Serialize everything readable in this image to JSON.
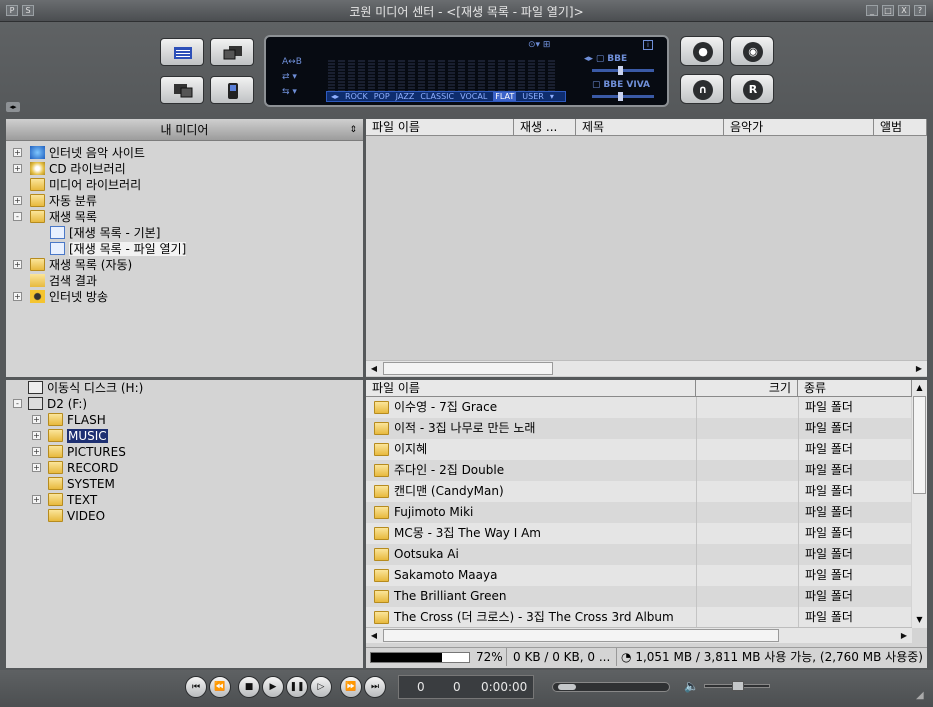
{
  "window": {
    "title": "코원 미디어 센터 - <[재생 목록 - 파일 열기]>",
    "left_buttons": [
      "P",
      "S"
    ],
    "right_buttons": [
      "_",
      "□",
      "X",
      "?"
    ]
  },
  "eq": {
    "ab": "A↔B",
    "presets": [
      "ROCK",
      "POP",
      "JAZZ",
      "CLASSIC",
      "VOCAL",
      "FLAT",
      "USER"
    ],
    "selected_preset": "FLAT",
    "bbe": "BBE",
    "viva": "BBE VIVA",
    "info": "i",
    "slider1_level": 0.45,
    "slider2_level": 0.45
  },
  "my_media": {
    "header": "내 미디어",
    "items": [
      {
        "label": "인터넷 음악 사이트",
        "expander": "+"
      },
      {
        "label": "CD 라이브러리",
        "expander": "+"
      },
      {
        "label": "미디어 라이브러리",
        "expander": ""
      },
      {
        "label": "자동 분류",
        "expander": "+"
      },
      {
        "label": "재생 목록",
        "expander": "-"
      },
      {
        "label": "[재생 목록 - 기본]",
        "expander": ""
      },
      {
        "label": "[재생 목록 - 파일 열기]",
        "expander": ""
      },
      {
        "label": "재생 목록 (자동)",
        "expander": "+"
      },
      {
        "label": "검색 결과",
        "expander": ""
      },
      {
        "label": "인터넷 방송",
        "expander": "+"
      }
    ]
  },
  "playlist": {
    "columns": [
      "파일 이름",
      "재생 ...",
      "제목",
      "음악가",
      "앨범"
    ]
  },
  "drives": {
    "items": [
      {
        "label": "이동식 디스크 (H:)",
        "expander": ""
      },
      {
        "label": "D2 (F:)",
        "expander": "-"
      },
      {
        "label": "FLASH",
        "expander": "+"
      },
      {
        "label": "MUSIC",
        "expander": "+"
      },
      {
        "label": "PICTURES",
        "expander": "+"
      },
      {
        "label": "RECORD",
        "expander": "+"
      },
      {
        "label": "SYSTEM",
        "expander": ""
      },
      {
        "label": "TEXT",
        "expander": "+"
      },
      {
        "label": "VIDEO",
        "expander": ""
      }
    ]
  },
  "files": {
    "columns": [
      "파일 이름",
      "크기",
      "종류"
    ],
    "rows": [
      {
        "name": "이수영 - 7집 Grace",
        "type": "파일 폴더"
      },
      {
        "name": "이적 - 3집 나무로 만든 노래",
        "type": "파일 폴더"
      },
      {
        "name": "이지혜",
        "type": "파일 폴더"
      },
      {
        "name": "주다인 - 2집 Double",
        "type": "파일 폴더"
      },
      {
        "name": "캔디맨 (CandyMan)",
        "type": "파일 폴더"
      },
      {
        "name": "Fujimoto Miki",
        "type": "파일 폴더"
      },
      {
        "name": "MC몽 - 3집 The Way I Am",
        "type": "파일 폴더"
      },
      {
        "name": "Ootsuka Ai",
        "type": "파일 폴더"
      },
      {
        "name": "Sakamoto Maaya",
        "type": "파일 폴더"
      },
      {
        "name": "The Brilliant Green",
        "type": "파일 폴더"
      },
      {
        "name": "The Cross (더 크로스) - 3집 The Cross 3rd Album",
        "type": "파일 폴더"
      }
    ]
  },
  "status": {
    "progress": 0.72,
    "percent": "72%",
    "transfer": "0 KB / 0 KB, 0 ...",
    "disk": "1,051 MB / 3,811 MB 사용 가능, (2,760 MB 사용중)"
  },
  "transport": {
    "counter_a": "0",
    "counter_b": "0",
    "time": "0:00:00",
    "position": 0.05,
    "volume": 0.5
  }
}
